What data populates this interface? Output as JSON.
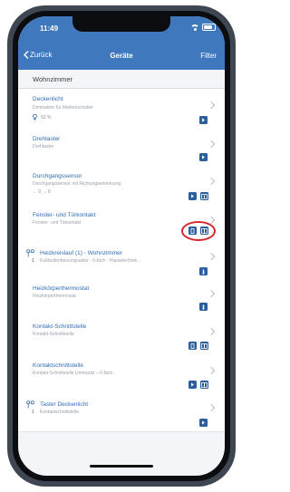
{
  "status": {
    "time": "11:49"
  },
  "nav": {
    "back_label": "Zurück",
    "title": "Geräte",
    "filter_label": "Filter"
  },
  "section": {
    "title": "Wohnzimmer"
  },
  "rows": [
    {
      "title": "Deckenlicht",
      "subtitle": "Dimmaktor für Markenschalter",
      "info": "52 %"
    },
    {
      "title": "Drehtaster",
      "subtitle": "Drehtaster"
    },
    {
      "title": "Durchgangssensor",
      "subtitle": "Durchgangssensor mit Richtungserkennung",
      "info": "← 0  → 0"
    },
    {
      "title": "Fenster- und Türkontakt",
      "subtitle": "Fenster- und Türkontakt"
    },
    {
      "title": "Heizkreislauf (1) - Wohnzimmer",
      "count": "1",
      "subtitle": "Fußbodenheizungsaktor - 6-fach - Hausetechnik..."
    },
    {
      "title": "Heizkörperthermostat",
      "subtitle": "Heizkörperthermostat"
    },
    {
      "title": "Kontakt-Schnittstelle",
      "subtitle": "Kontakt-Schnittstelle"
    },
    {
      "title": "Kontaktschnittstelle",
      "subtitle": "Kontakt-Schnittstelle Unterputz – 6-fach"
    },
    {
      "title": "Taster Deckenlicht",
      "count": "1",
      "subtitle": "Kontaktschnittstelle"
    }
  ],
  "colors": {
    "accent": "#3f78bd",
    "button": "#2b5f9e",
    "highlight": "#d8242c"
  }
}
